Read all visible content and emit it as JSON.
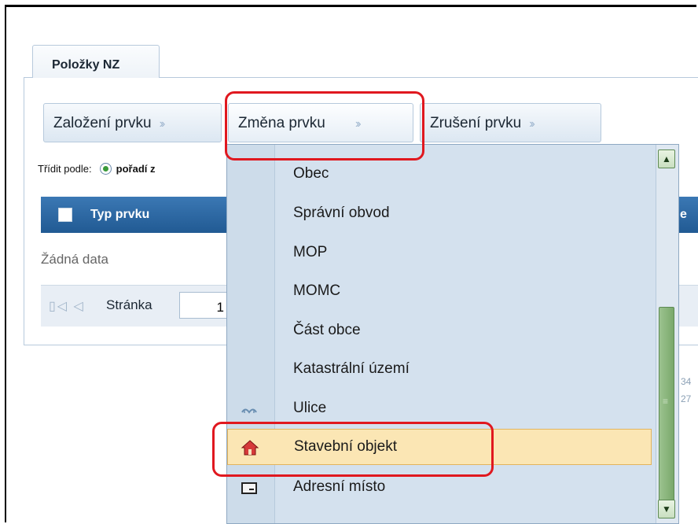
{
  "tab": {
    "label": "Položky NZ"
  },
  "actions": {
    "zalozeni": "Založení prvku",
    "zmena": "Změna prvku",
    "zruseni": "Zrušení prvku"
  },
  "sort": {
    "label": "Třídit podle:",
    "option": "pořadí z"
  },
  "table": {
    "header": "Typ prvku",
    "header2": "e",
    "empty": "Žádná data"
  },
  "pager": {
    "label": "Stránka",
    "value": "1"
  },
  "side_fragments": [
    "34",
    "27"
  ],
  "menu": {
    "items": [
      {
        "label": "Obec",
        "icon": ""
      },
      {
        "label": "Správní obvod",
        "icon": ""
      },
      {
        "label": "MOP",
        "icon": ""
      },
      {
        "label": "MOMC",
        "icon": ""
      },
      {
        "label": "Část obce",
        "icon": ""
      },
      {
        "label": "Katastrální území",
        "icon": ""
      },
      {
        "label": "Ulice",
        "icon": "street-icon"
      },
      {
        "label": "Stavební objekt",
        "icon": "house-icon",
        "active": true
      },
      {
        "label": "Adresní místo",
        "icon": "address-plate-icon"
      }
    ]
  },
  "colors": {
    "accent": "#215a93",
    "highlight_outline": "#e0181f",
    "menu_hover": "#fbe6b4",
    "scrollbar": "#79a86b"
  }
}
